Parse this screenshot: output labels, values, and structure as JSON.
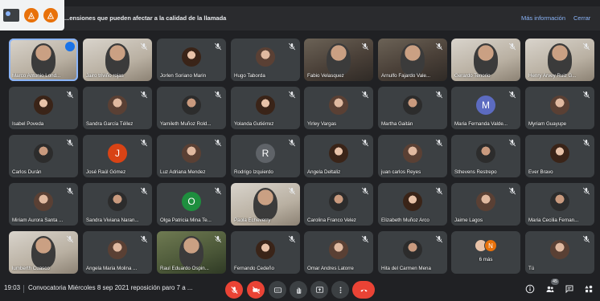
{
  "banner": {
    "text": "...ensiones que pueden afectar a la calidad de la llamada",
    "more_info": "Más información",
    "close": "Cerrar"
  },
  "participants": [
    {
      "name": "Marco Antonio Lond...",
      "kind": "video"
    },
    {
      "name": "Jairo triviño rojas",
      "kind": "video"
    },
    {
      "name": "Jorlen Soriano Marin",
      "kind": "avatar"
    },
    {
      "name": "Hugo Taborda",
      "kind": "avatar"
    },
    {
      "name": "Fabio Velasquez",
      "kind": "video"
    },
    {
      "name": "Arnulfo Fajardo Vale...",
      "kind": "video"
    },
    {
      "name": "Gerardo Tenorio",
      "kind": "video"
    },
    {
      "name": "Henry Arvey Ruiz G...",
      "kind": "video"
    },
    {
      "name": "Isabel Poveda",
      "kind": "avatar"
    },
    {
      "name": "Sandra García Téllez",
      "kind": "avatar"
    },
    {
      "name": "Yamileth Muñoz Rold...",
      "kind": "avatar"
    },
    {
      "name": "Yolanda Gutiérrez",
      "kind": "avatar"
    },
    {
      "name": "Yirley Vargas",
      "kind": "avatar"
    },
    {
      "name": "Martha Gaitán",
      "kind": "avatar"
    },
    {
      "name": "Maria Fernanda Valde...",
      "kind": "letter",
      "letter": "M"
    },
    {
      "name": "Myriam Guayupe",
      "kind": "avatar"
    },
    {
      "name": "Carlos Durán",
      "kind": "avatar"
    },
    {
      "name": "José Raúl Gómez",
      "kind": "letter",
      "letter": "J"
    },
    {
      "name": "Luz Adriana Mendez",
      "kind": "avatar"
    },
    {
      "name": "Rodrigo Izquierdo",
      "kind": "letter",
      "letter": "R"
    },
    {
      "name": "Angela Deltaliz",
      "kind": "avatar"
    },
    {
      "name": "juan carlos Reyes",
      "kind": "avatar"
    },
    {
      "name": "Sthevens Restrepo",
      "kind": "avatar"
    },
    {
      "name": "Ever Bravo",
      "kind": "avatar"
    },
    {
      "name": "Miriam Aurora Santa ...",
      "kind": "avatar"
    },
    {
      "name": "Sandra Viviana Naran...",
      "kind": "avatar"
    },
    {
      "name": "Olga Patricia Mina Te...",
      "kind": "letter",
      "letter": "O"
    },
    {
      "name": "Paola Echeverry",
      "kind": "video"
    },
    {
      "name": "Carolina Franco Velez",
      "kind": "avatar"
    },
    {
      "name": "Elizabeth Muñoz Arco",
      "kind": "avatar"
    },
    {
      "name": "Jaime Lagos",
      "kind": "avatar"
    },
    {
      "name": "Maria Cecilia Fernan...",
      "kind": "avatar"
    },
    {
      "name": "lumberth Cuasco",
      "kind": "video"
    },
    {
      "name": "Angela Maria Molina ...",
      "kind": "avatar"
    },
    {
      "name": "Raul Eduardo Ospin...",
      "kind": "video"
    },
    {
      "name": "Fernando Cedeño",
      "kind": "avatar"
    },
    {
      "name": "Omar Andres Latorre",
      "kind": "avatar"
    },
    {
      "name": "Hita del Carmen Mena",
      "kind": "avatar"
    },
    {
      "name": "6 más",
      "kind": "more",
      "letter": "N"
    },
    {
      "name": "Tú",
      "kind": "avatar"
    }
  ],
  "bottom": {
    "time": "19:03",
    "separator": "|",
    "meeting_title": "Convocatoria Miércoles 8 sep 2021 reposición paro 7 a ...",
    "cc_label": "CC",
    "participant_count": "45"
  },
  "colors": {
    "background": "#202124",
    "tile": "#3c4043",
    "end_call": "#ea4335",
    "link": "#8ab4f8",
    "letter_M": "#5c6bc0",
    "letter_J": "#d84315",
    "letter_R": "#5f6368",
    "letter_O": "#1e8e3e"
  }
}
